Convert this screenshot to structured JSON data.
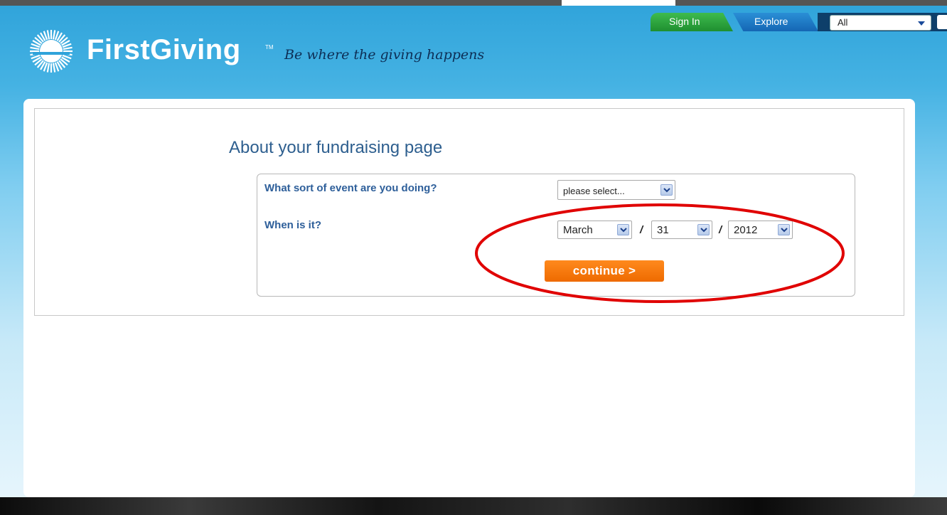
{
  "nav": {
    "sign_in": "Sign In",
    "explore": "Explore",
    "search_scope": "All"
  },
  "header": {
    "brand": "FirstGiving",
    "tm": "TM",
    "tagline": "Be where the giving happens"
  },
  "form": {
    "title": "About your fundraising page",
    "event_question": "What sort of event are you doing?",
    "event_select_value": "please select...",
    "date_question": "When is it?",
    "month": "March",
    "day": "31",
    "year": "2012",
    "separator": "/",
    "continue_label": "continue >"
  },
  "colors": {
    "sky_blue": "#2fa3da",
    "brand_navy": "#0d2e55",
    "title_blue": "#2e5f8f",
    "button_orange": "#ee6a00",
    "annotation_red": "#e00000",
    "signin_green": "#1f8f30",
    "explore_blue": "#1566b4"
  }
}
